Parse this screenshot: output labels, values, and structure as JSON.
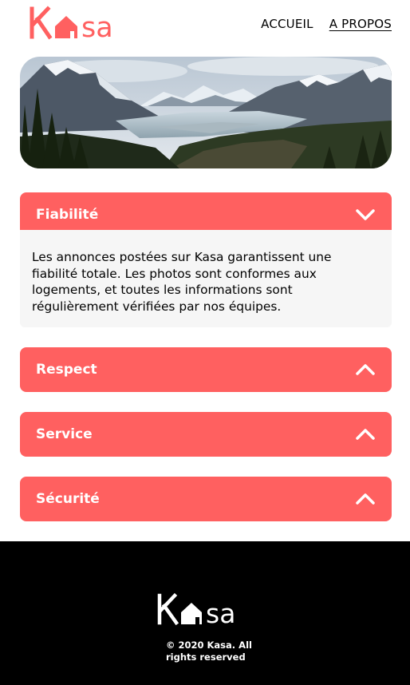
{
  "header": {
    "logo_text": "Kasa",
    "nav": [
      {
        "label": "ACCUEIL",
        "active": false
      },
      {
        "label": "A PROPOS",
        "active": true
      }
    ]
  },
  "banner": {
    "scene": "mountain-lake-landscape"
  },
  "sections": [
    {
      "title": "Fiabilité",
      "expanded": true,
      "content": "Les annonces postées sur Kasa garantissent une fiabilité totale. Les photos sont conformes aux logements, et toutes les informations sont régulièrement vérifiées par nos équipes."
    },
    {
      "title": "Respect",
      "expanded": false
    },
    {
      "title": "Service",
      "expanded": false
    },
    {
      "title": "Sécurité",
      "expanded": false
    }
  ],
  "footer": {
    "logo_text": "Kasa",
    "copyright": "© 2020 Kasa. All rights reserved"
  },
  "colors": {
    "brand": "#FF6060",
    "content_bg": "#F6F6F6",
    "footer_bg": "#000000"
  },
  "icons": [
    "house-icon",
    "chevron-down-icon",
    "chevron-up-icon"
  ]
}
